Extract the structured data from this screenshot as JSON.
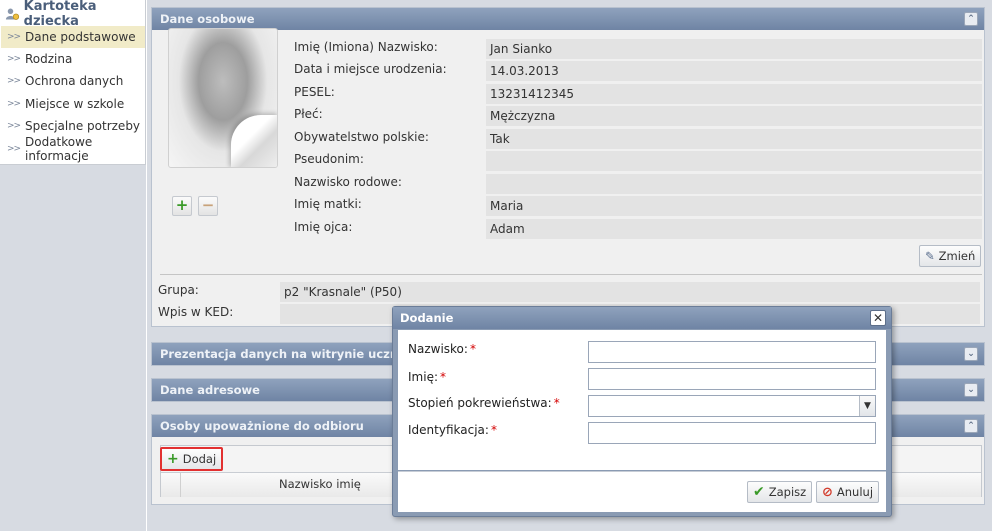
{
  "sidebar": {
    "title": "Kartoteka dziecka",
    "items": [
      {
        "label": "Dane podstawowe",
        "active": true
      },
      {
        "label": "Rodzina"
      },
      {
        "label": "Ochrona danych"
      },
      {
        "label": "Miejsce w szkole"
      },
      {
        "label": "Specjalne potrzeby"
      },
      {
        "label": "Dodatkowe informacje"
      }
    ]
  },
  "personal": {
    "title": "Dane osobowe",
    "fields": [
      {
        "label": "Imię (Imiona) Nazwisko:",
        "value": "Jan Sianko"
      },
      {
        "label": "Data i miejsce urodzenia:",
        "value": "14.03.2013"
      },
      {
        "label": "PESEL:",
        "value": "13231412345"
      },
      {
        "label": "Płeć:",
        "value": "Mężczyzna"
      },
      {
        "label": "Obywatelstwo polskie:",
        "value": "Tak"
      },
      {
        "label": "Pseudonim:",
        "value": ""
      },
      {
        "label": "Nazwisko rodowe:",
        "value": ""
      },
      {
        "label": "Imię matki:",
        "value": "Maria"
      },
      {
        "label": "Imię ojca:",
        "value": "Adam"
      }
    ],
    "change_label": "Zmień",
    "group_label": "Grupa:",
    "group_value": "p2 \"Krasnale\" (P50)",
    "ked_label": "Wpis w KED:",
    "ked_value": ""
  },
  "panels": {
    "presentation": "Prezentacja danych na witrynie ucznia",
    "address": "Dane adresowe",
    "authorized": "Osoby upoważnione do odbioru"
  },
  "authorized": {
    "add_label": "Dodaj",
    "column_name": "Nazwisko imię"
  },
  "dialog": {
    "title": "Dodanie",
    "fields": [
      {
        "label": "Nazwisko:",
        "value": ""
      },
      {
        "label": "Imię:",
        "value": ""
      },
      {
        "label": "Stopień pokrewieństwa:",
        "value": ""
      },
      {
        "label": "Identyfikacja:",
        "value": ""
      }
    ],
    "save_label": "Zapisz",
    "cancel_label": "Anuluj"
  },
  "colors": {
    "panel_header": "#7a8eac",
    "active_item": "#f1ebc8",
    "required": "#d40000",
    "save_check": "#3a9a28",
    "cancel_icon": "#d33a2a",
    "add_plus": "#3a9a28",
    "highlight_border": "#e23030"
  }
}
